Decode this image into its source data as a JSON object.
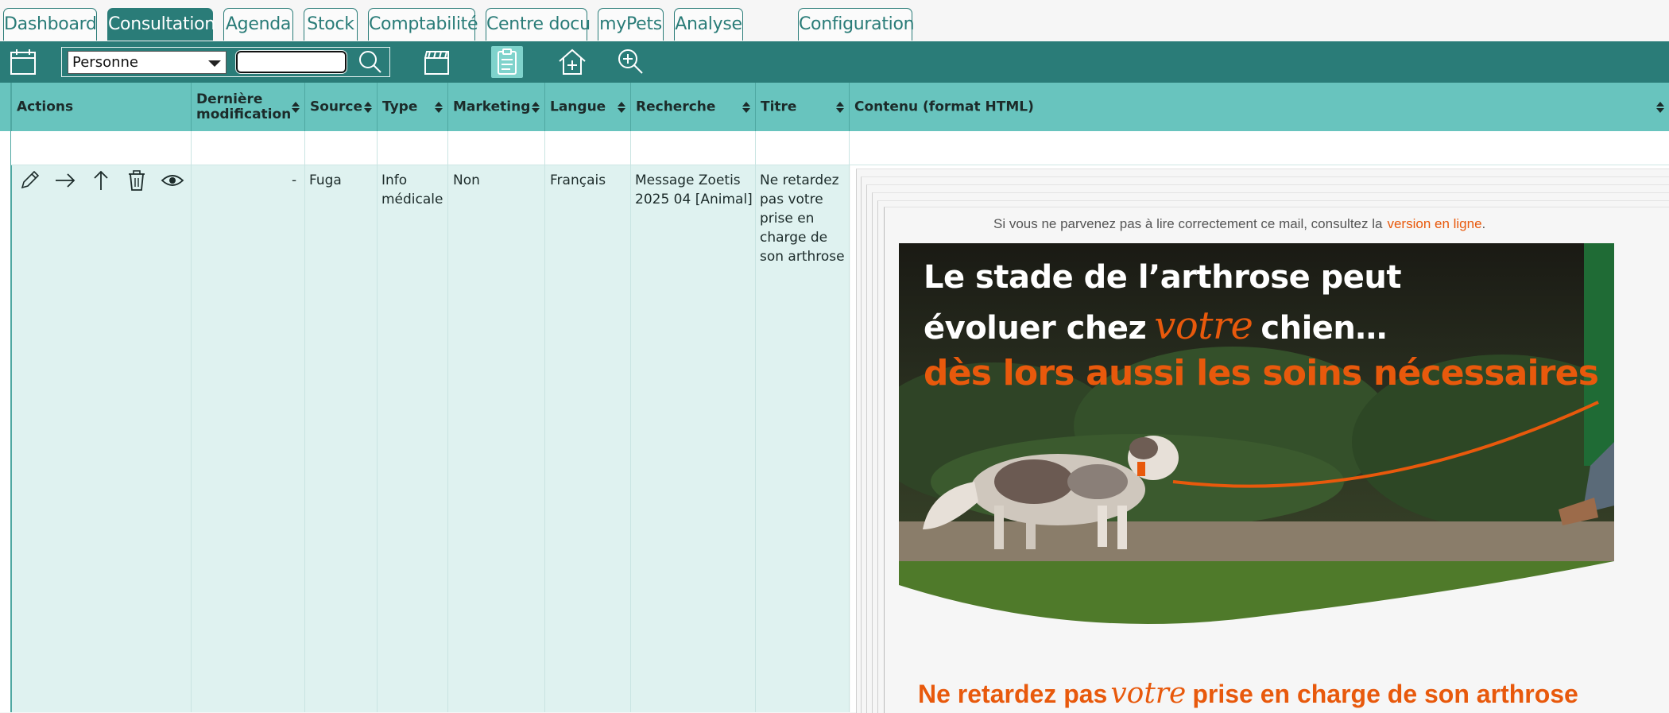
{
  "tabs": [
    {
      "label": "Dashboard",
      "active": false
    },
    {
      "label": "Consultation",
      "active": true
    },
    {
      "label": "Agenda",
      "active": false
    },
    {
      "label": "Stock",
      "active": false
    },
    {
      "label": "Comptabilité",
      "active": false
    },
    {
      "label": "Centre docu",
      "active": false
    },
    {
      "label": "myPets",
      "active": false
    },
    {
      "label": "Analyse",
      "active": false
    },
    {
      "label": "Configuration",
      "active": false
    }
  ],
  "toolbar": {
    "search_type_selected": "Personne",
    "search_value": "",
    "icons": [
      "calendar-icon",
      "search-icon",
      "clapperboard-icon",
      "clipboard-icon",
      "home-add-icon",
      "zoom-in-icon"
    ]
  },
  "table": {
    "columns": [
      "Actions",
      "Dernière modification",
      "Source",
      "Type",
      "Marketing",
      "Langue",
      "Recherche",
      "Titre",
      "Contenu (format HTML)"
    ],
    "row": {
      "actions": [
        "edit-icon",
        "arrow-right-icon",
        "arrow-up-icon",
        "trash-icon",
        "eye-icon"
      ],
      "derniere_modification": "-",
      "source": "Fuga",
      "type": "Info médicale",
      "marketing": "Non",
      "langue": "Français",
      "recherche": "Message Zoetis 2025 04 [Animal]",
      "titre": "Ne retardez pas votre prise en charge de son arthrose"
    }
  },
  "email": {
    "online_notice": "Si vous ne parvenez pas à lire correctement ce mail, consultez la",
    "online_link": "version en ligne",
    "online_suffix": ".",
    "headline_line1": "Le stade de l’arthrose peut",
    "headline_line2_pre": "évoluer chez",
    "headline_line2_script": "votre",
    "headline_line2_post": "chien…",
    "headline_line3": "dès lors aussi les soins nécessaires",
    "footer_pre": "Ne retardez pas",
    "footer_script": "votre",
    "footer_post": "prise en charge de son arthrose"
  },
  "colors": {
    "brand_teal": "#2a7c78",
    "header_teal": "#68c4be",
    "row_bg": "#dff2f0",
    "accent_orange": "#e8590c"
  }
}
